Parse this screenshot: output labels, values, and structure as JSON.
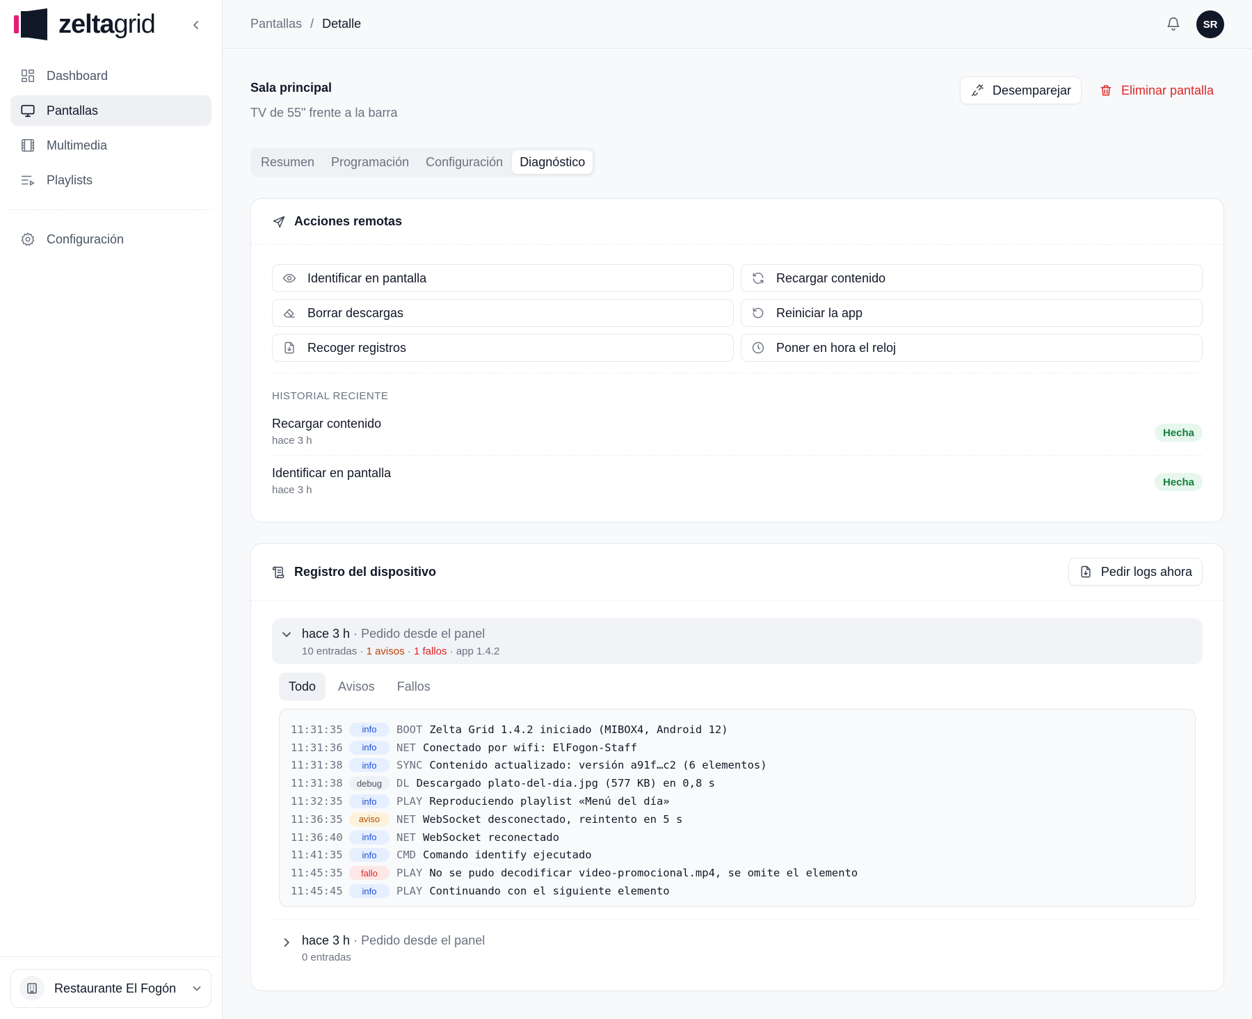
{
  "app": {
    "logo_bold": "zelta",
    "logo_light": "grid",
    "colors": {
      "brand_pink": "#e11d74",
      "brand_dark": "#111827",
      "danger": "#dc2626",
      "success": "#15803d"
    }
  },
  "sidebar": {
    "items": [
      {
        "label": "Dashboard",
        "icon": "grid-icon",
        "active": false
      },
      {
        "label": "Pantallas",
        "icon": "monitor-icon",
        "active": true
      },
      {
        "label": "Multimedia",
        "icon": "film-icon",
        "active": false
      },
      {
        "label": "Playlists",
        "icon": "playlist-icon",
        "active": false
      }
    ],
    "settings_label": "Configuración",
    "workspace_name": "Restaurante El Fogón"
  },
  "header": {
    "breadcrumb_parent": "Pantallas",
    "breadcrumb_sep": "/",
    "breadcrumb_current": "Detalle",
    "avatar_initials": "SR"
  },
  "screen": {
    "name": "Sala principal",
    "description": "TV de 55\" frente a la barra",
    "unpair_label": "Desemparejar",
    "delete_label": "Eliminar pantalla"
  },
  "tabs": [
    "Resumen",
    "Programación",
    "Configuración",
    "Diagnóstico"
  ],
  "active_tab": "Diagnóstico",
  "remote_actions": {
    "title": "Acciones remotas",
    "buttons": [
      {
        "label": "Identificar en pantalla",
        "icon": "eye-icon"
      },
      {
        "label": "Recargar contenido",
        "icon": "refresh-icon"
      },
      {
        "label": "Borrar descargas",
        "icon": "eraser-icon"
      },
      {
        "label": "Reiniciar la app",
        "icon": "restart-icon"
      },
      {
        "label": "Recoger registros",
        "icon": "file-download-icon"
      },
      {
        "label": "Poner en hora el reloj",
        "icon": "clock-icon"
      }
    ],
    "history_label": "HISTORIAL RECIENTE",
    "history": [
      {
        "action": "Recargar contenido",
        "time": "hace 3 h",
        "status": "Hecha"
      },
      {
        "action": "Identificar en pantalla",
        "time": "hace 3 h",
        "status": "Hecha"
      }
    ]
  },
  "device_log": {
    "title": "Registro del dispositivo",
    "request_label": "Pedir logs ahora",
    "groups": [
      {
        "time": "hace 3 h",
        "source": "· Pedido desde el panel",
        "entries": "10 entradas",
        "sep": "·",
        "warnings": "1 avisos",
        "errors": "1 fallos",
        "app": "app 1.4.2"
      },
      {
        "time": "hace 3 h",
        "source": "· Pedido desde el panel",
        "entries": "0 entradas"
      }
    ],
    "filters": [
      "Todo",
      "Avisos",
      "Fallos"
    ],
    "lines": [
      {
        "t": "11:31:35",
        "lvl": "info",
        "src": "BOOT",
        "msg": "Zelta Grid 1.4.2 iniciado (MIBOX4, Android 12)"
      },
      {
        "t": "11:31:36",
        "lvl": "info",
        "src": "NET",
        "msg": "Conectado por wifi: ElFogon-Staff"
      },
      {
        "t": "11:31:38",
        "lvl": "info",
        "src": "SYNC",
        "msg": "Contenido actualizado: versión a91f…c2 (6 elementos)"
      },
      {
        "t": "11:31:38",
        "lvl": "debug",
        "src": "DL",
        "msg": "Descargado plato-del-dia.jpg (577 KB) en 0,8 s"
      },
      {
        "t": "11:32:35",
        "lvl": "info",
        "src": "PLAY",
        "msg": "Reproduciendo playlist «Menú del día»"
      },
      {
        "t": "11:36:35",
        "lvl": "aviso",
        "src": "NET",
        "msg": "WebSocket desconectado, reintento en 5 s"
      },
      {
        "t": "11:36:40",
        "lvl": "info",
        "src": "NET",
        "msg": "WebSocket reconectado"
      },
      {
        "t": "11:41:35",
        "lvl": "info",
        "src": "CMD",
        "msg": "Comando identify ejecutado"
      },
      {
        "t": "11:45:35",
        "lvl": "fallo",
        "src": "PLAY",
        "msg": "No se pudo decodificar video-promocional.mp4, se omite el elemento"
      },
      {
        "t": "11:45:45",
        "lvl": "info",
        "src": "PLAY",
        "msg": "Continuando con el siguiente elemento"
      }
    ]
  }
}
